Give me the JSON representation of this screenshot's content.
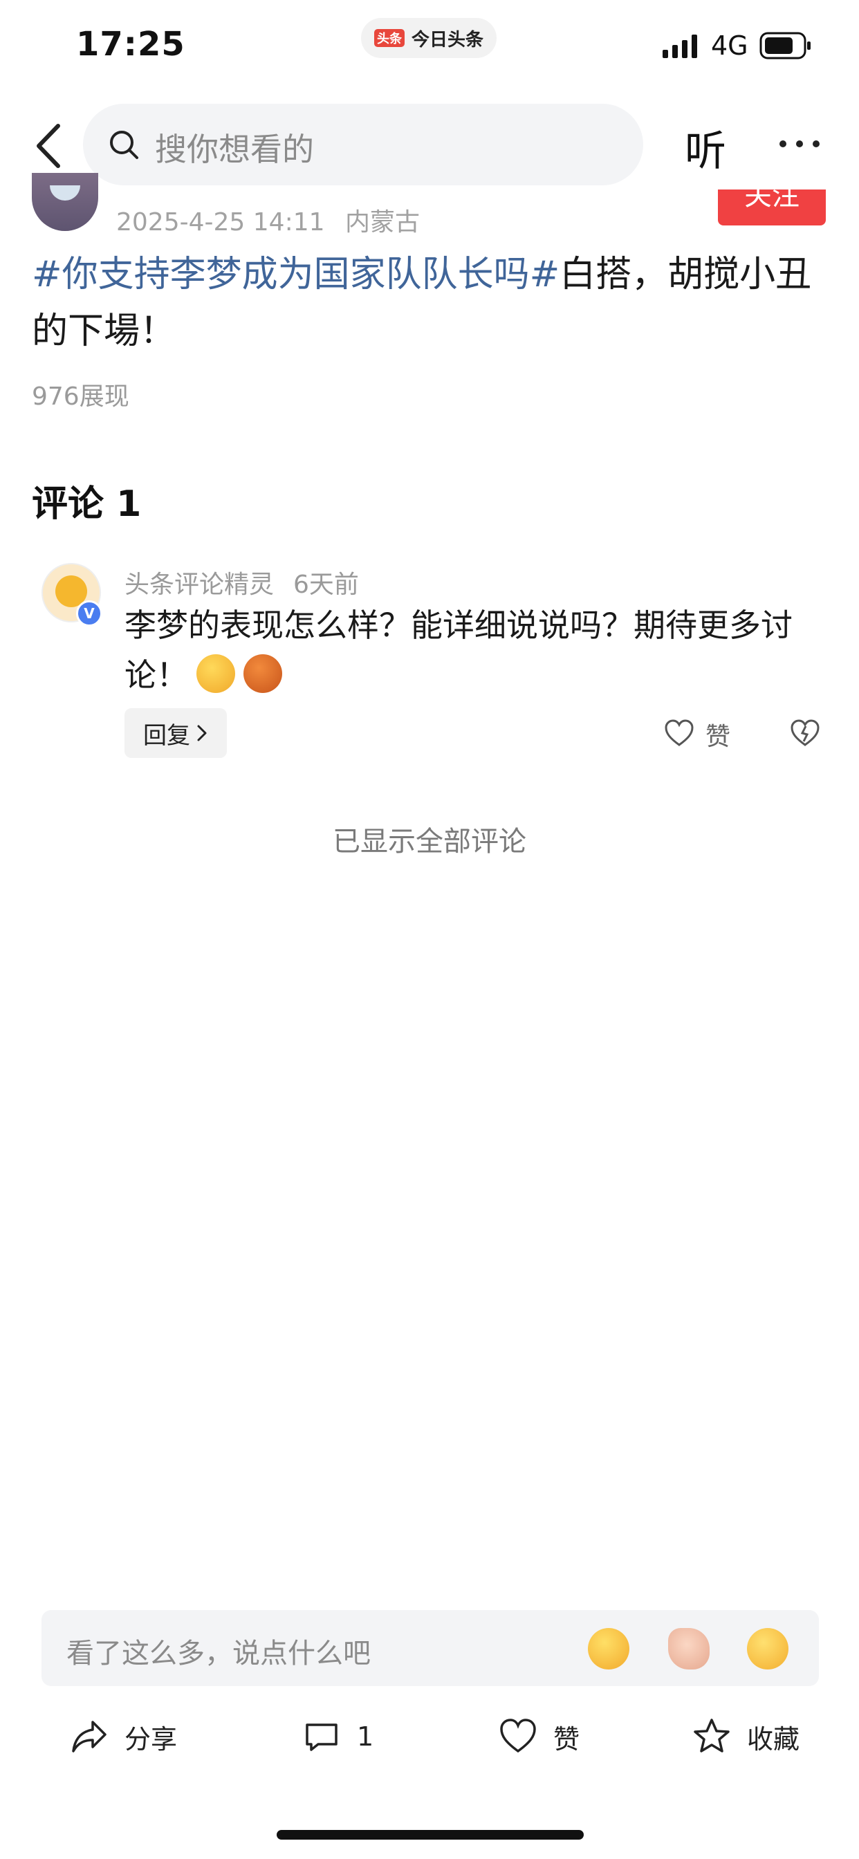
{
  "status_bar": {
    "time": "17:25",
    "network": "4G",
    "app_badge": "头条",
    "app_name": "今日头条"
  },
  "nav": {
    "search_placeholder": "搜你想看的",
    "listen_label": "听"
  },
  "author": {
    "post_time": "2025-4-25 14:11",
    "location": "内蒙古",
    "follow_label": "关注"
  },
  "post": {
    "hashtag": "#你支持李梦成为国家队队长吗#",
    "text": "白搭，胡搅小丑的下場！",
    "views": "976展现"
  },
  "comments": {
    "heading": "评论 1",
    "items": [
      {
        "name": "头条评论精灵",
        "time": "6天前",
        "text": "李梦的表现怎么样？能详细说说吗？期待更多讨论！",
        "verified_badge": "V",
        "reply_label": "回复",
        "like_label": "赞"
      }
    ],
    "all_shown": "已显示全部评论"
  },
  "comment_input": {
    "placeholder": "看了这么多，说点什么吧"
  },
  "toolbar": {
    "share": "分享",
    "comments": "1",
    "like": "赞",
    "favorite": "收藏"
  },
  "colors": {
    "accent": "#f04142",
    "hashtag": "#406599"
  }
}
